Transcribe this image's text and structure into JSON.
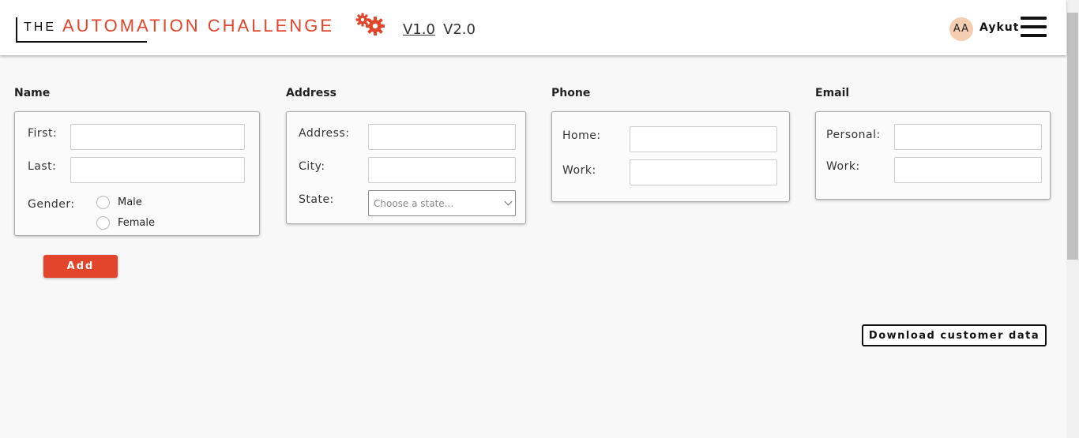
{
  "header": {
    "logo_prefix": "THE",
    "logo_main": "AUTOMATION CHALLENGE",
    "logo_icon": "gears-icon",
    "versions": [
      "V1.0",
      "V2.0"
    ],
    "user_initials": "AA",
    "user_name": "Aykut",
    "menu_icon": "hamburger-icon"
  },
  "colors": {
    "accent": "#e2452b",
    "avatar_bg": "#f5cdb0",
    "page_bg": "#f8f8f8"
  },
  "sections": {
    "name": {
      "title": "Name",
      "first_label": "First:",
      "first_value": "",
      "last_label": "Last:",
      "last_value": "",
      "gender_label": "Gender:",
      "gender_options": [
        "Male",
        "Female"
      ]
    },
    "address": {
      "title": "Address",
      "address_label": "Address:",
      "address_value": "",
      "city_label": "City:",
      "city_value": "",
      "state_label": "State:",
      "state_placeholder": "Choose a state..."
    },
    "phone": {
      "title": "Phone",
      "home_label": "Home:",
      "home_value": "",
      "work_label": "Work:",
      "work_value": ""
    },
    "email": {
      "title": "Email",
      "personal_label": "Personal:",
      "personal_value": "",
      "work_label": "Work:",
      "work_value": ""
    }
  },
  "actions": {
    "add_label": "Add",
    "download_label": "Download customer data"
  }
}
